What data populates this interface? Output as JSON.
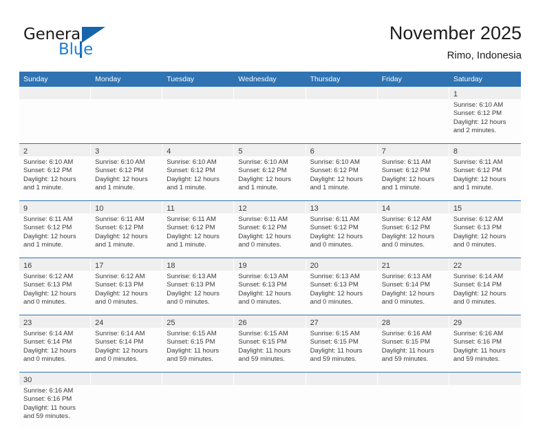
{
  "brand": {
    "name_top": "General",
    "name_bottom": "Blue",
    "triangle_color": "#1565ad",
    "blue_text_color": "#1c7fd4"
  },
  "header": {
    "title": "November 2025",
    "subtitle": "Rimo, Indonesia",
    "accent_color": "#2f73b3"
  },
  "weekdays": [
    "Sunday",
    "Monday",
    "Tuesday",
    "Wednesday",
    "Thursday",
    "Friday",
    "Saturday"
  ],
  "weeks": [
    [
      {
        "day": "",
        "lines": []
      },
      {
        "day": "",
        "lines": []
      },
      {
        "day": "",
        "lines": []
      },
      {
        "day": "",
        "lines": []
      },
      {
        "day": "",
        "lines": []
      },
      {
        "day": "",
        "lines": []
      },
      {
        "day": "1",
        "lines": [
          "Sunrise: 6:10 AM",
          "Sunset: 6:12 PM",
          "Daylight: 12 hours",
          "and 2 minutes."
        ]
      }
    ],
    [
      {
        "day": "2",
        "lines": [
          "Sunrise: 6:10 AM",
          "Sunset: 6:12 PM",
          "Daylight: 12 hours",
          "and 1 minute."
        ]
      },
      {
        "day": "3",
        "lines": [
          "Sunrise: 6:10 AM",
          "Sunset: 6:12 PM",
          "Daylight: 12 hours",
          "and 1 minute."
        ]
      },
      {
        "day": "4",
        "lines": [
          "Sunrise: 6:10 AM",
          "Sunset: 6:12 PM",
          "Daylight: 12 hours",
          "and 1 minute."
        ]
      },
      {
        "day": "5",
        "lines": [
          "Sunrise: 6:10 AM",
          "Sunset: 6:12 PM",
          "Daylight: 12 hours",
          "and 1 minute."
        ]
      },
      {
        "day": "6",
        "lines": [
          "Sunrise: 6:10 AM",
          "Sunset: 6:12 PM",
          "Daylight: 12 hours",
          "and 1 minute."
        ]
      },
      {
        "day": "7",
        "lines": [
          "Sunrise: 6:11 AM",
          "Sunset: 6:12 PM",
          "Daylight: 12 hours",
          "and 1 minute."
        ]
      },
      {
        "day": "8",
        "lines": [
          "Sunrise: 6:11 AM",
          "Sunset: 6:12 PM",
          "Daylight: 12 hours",
          "and 1 minute."
        ]
      }
    ],
    [
      {
        "day": "9",
        "lines": [
          "Sunrise: 6:11 AM",
          "Sunset: 6:12 PM",
          "Daylight: 12 hours",
          "and 1 minute."
        ]
      },
      {
        "day": "10",
        "lines": [
          "Sunrise: 6:11 AM",
          "Sunset: 6:12 PM",
          "Daylight: 12 hours",
          "and 1 minute."
        ]
      },
      {
        "day": "11",
        "lines": [
          "Sunrise: 6:11 AM",
          "Sunset: 6:12 PM",
          "Daylight: 12 hours",
          "and 1 minute."
        ]
      },
      {
        "day": "12",
        "lines": [
          "Sunrise: 6:11 AM",
          "Sunset: 6:12 PM",
          "Daylight: 12 hours",
          "and 0 minutes."
        ]
      },
      {
        "day": "13",
        "lines": [
          "Sunrise: 6:11 AM",
          "Sunset: 6:12 PM",
          "Daylight: 12 hours",
          "and 0 minutes."
        ]
      },
      {
        "day": "14",
        "lines": [
          "Sunrise: 6:12 AM",
          "Sunset: 6:12 PM",
          "Daylight: 12 hours",
          "and 0 minutes."
        ]
      },
      {
        "day": "15",
        "lines": [
          "Sunrise: 6:12 AM",
          "Sunset: 6:13 PM",
          "Daylight: 12 hours",
          "and 0 minutes."
        ]
      }
    ],
    [
      {
        "day": "16",
        "lines": [
          "Sunrise: 6:12 AM",
          "Sunset: 6:13 PM",
          "Daylight: 12 hours",
          "and 0 minutes."
        ]
      },
      {
        "day": "17",
        "lines": [
          "Sunrise: 6:12 AM",
          "Sunset: 6:13 PM",
          "Daylight: 12 hours",
          "and 0 minutes."
        ]
      },
      {
        "day": "18",
        "lines": [
          "Sunrise: 6:13 AM",
          "Sunset: 6:13 PM",
          "Daylight: 12 hours",
          "and 0 minutes."
        ]
      },
      {
        "day": "19",
        "lines": [
          "Sunrise: 6:13 AM",
          "Sunset: 6:13 PM",
          "Daylight: 12 hours",
          "and 0 minutes."
        ]
      },
      {
        "day": "20",
        "lines": [
          "Sunrise: 6:13 AM",
          "Sunset: 6:13 PM",
          "Daylight: 12 hours",
          "and 0 minutes."
        ]
      },
      {
        "day": "21",
        "lines": [
          "Sunrise: 6:13 AM",
          "Sunset: 6:14 PM",
          "Daylight: 12 hours",
          "and 0 minutes."
        ]
      },
      {
        "day": "22",
        "lines": [
          "Sunrise: 6:14 AM",
          "Sunset: 6:14 PM",
          "Daylight: 12 hours",
          "and 0 minutes."
        ]
      }
    ],
    [
      {
        "day": "23",
        "lines": [
          "Sunrise: 6:14 AM",
          "Sunset: 6:14 PM",
          "Daylight: 12 hours",
          "and 0 minutes."
        ]
      },
      {
        "day": "24",
        "lines": [
          "Sunrise: 6:14 AM",
          "Sunset: 6:14 PM",
          "Daylight: 12 hours",
          "and 0 minutes."
        ]
      },
      {
        "day": "25",
        "lines": [
          "Sunrise: 6:15 AM",
          "Sunset: 6:15 PM",
          "Daylight: 11 hours",
          "and 59 minutes."
        ]
      },
      {
        "day": "26",
        "lines": [
          "Sunrise: 6:15 AM",
          "Sunset: 6:15 PM",
          "Daylight: 11 hours",
          "and 59 minutes."
        ]
      },
      {
        "day": "27",
        "lines": [
          "Sunrise: 6:15 AM",
          "Sunset: 6:15 PM",
          "Daylight: 11 hours",
          "and 59 minutes."
        ]
      },
      {
        "day": "28",
        "lines": [
          "Sunrise: 6:16 AM",
          "Sunset: 6:15 PM",
          "Daylight: 11 hours",
          "and 59 minutes."
        ]
      },
      {
        "day": "29",
        "lines": [
          "Sunrise: 6:16 AM",
          "Sunset: 6:16 PM",
          "Daylight: 11 hours",
          "and 59 minutes."
        ]
      }
    ],
    [
      {
        "day": "30",
        "lines": [
          "Sunrise: 6:16 AM",
          "Sunset: 6:16 PM",
          "Daylight: 11 hours",
          "and 59 minutes."
        ]
      },
      {
        "day": "",
        "lines": []
      },
      {
        "day": "",
        "lines": []
      },
      {
        "day": "",
        "lines": []
      },
      {
        "day": "",
        "lines": []
      },
      {
        "day": "",
        "lines": []
      },
      {
        "day": "",
        "lines": []
      }
    ]
  ]
}
